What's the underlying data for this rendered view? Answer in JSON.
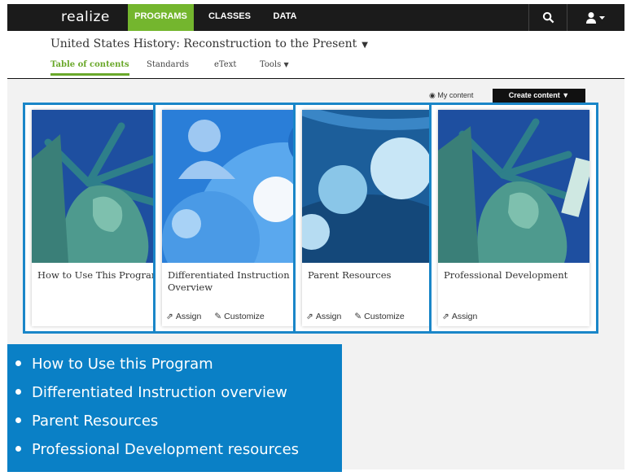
{
  "nav": {
    "logo": "realize",
    "items": [
      {
        "label": "PROGRAMS",
        "active": true
      },
      {
        "label": "CLASSES",
        "active": false
      },
      {
        "label": "DATA",
        "active": false
      }
    ],
    "icons": [
      "search-icon",
      "user-icon"
    ]
  },
  "header": {
    "course_title": "United States History: Reconstruction to the Present",
    "tabs": [
      {
        "label": "Table of contents",
        "active": true
      },
      {
        "label": "Standards"
      },
      {
        "label": "eText"
      },
      {
        "label": "Tools"
      }
    ]
  },
  "toolbar": {
    "my_content": "My content",
    "create_content": "Create content"
  },
  "cards": [
    {
      "title": "How to Use This Program",
      "actions": []
    },
    {
      "title": "Differentiated Instruction Overview",
      "actions": [
        "Assign",
        "Customize"
      ]
    },
    {
      "title": "Parent Resources",
      "actions": [
        "Assign",
        "Customize"
      ]
    },
    {
      "title": "Professional Development",
      "actions": [
        "Assign"
      ]
    }
  ],
  "summary": [
    "How to Use this Program",
    "Differentiated Instruction overview",
    "Parent Resources",
    "Professional Development resources"
  ],
  "colors": {
    "accent_green": "#74b62e",
    "highlight_blue": "#0a80c6",
    "nav_bg": "#1b1b1b"
  }
}
